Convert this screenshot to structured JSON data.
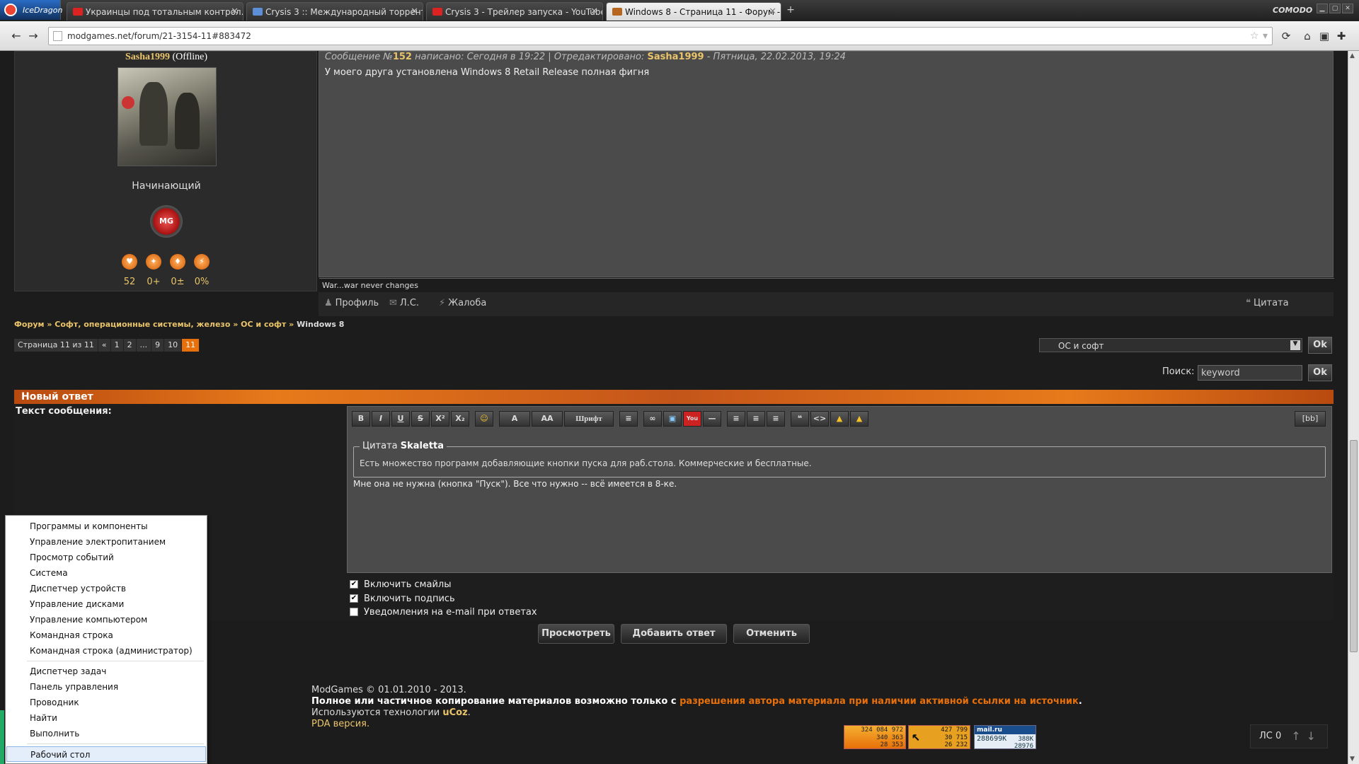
{
  "browser": {
    "name": "IceDragon",
    "comodo_label": "COMODO",
    "tabs": [
      {
        "title": "Украинцы под тотальным контрол...",
        "fav_color": "#d22"
      },
      {
        "title": "Crysis 3 :: Международный торрент-...",
        "fav_color": "#5c8fd6"
      },
      {
        "title": "Crysis 3 - Трейлер запуска - YouTube",
        "fav_color": "#d22"
      },
      {
        "title": "Windows 8 - Страница 11 - Форум -...",
        "fav_color": "#b5651d"
      }
    ],
    "url": "modgames.net/forum/21-3154-11#883472"
  },
  "post": {
    "username": "Sasha1999",
    "status": "(Offline)",
    "rank": "Начинающий",
    "badge": "MG",
    "stats": [
      "52",
      "0+",
      "0±",
      "0%"
    ],
    "meta_prefix": "Сообщение №",
    "meta_number": "152",
    "meta_written": " написано: Сегодня в 19:22 | ",
    "meta_edited": "Отредактировано: ",
    "meta_editor": "Sasha1999",
    "meta_edit_date": " - Пятница, 22.02.2013, 19:24",
    "text": "У моего друга установлена Windows 8 Retail Release полная фигня",
    "signature": "War...war never changes",
    "actions": {
      "profile": "Профиль",
      "pm": "Л.С.",
      "report": "Жалоба",
      "quote": "Цитата"
    }
  },
  "breadcrumb": {
    "forum": "Форум",
    "sep": " » ",
    "section": "Софт, операционные системы, железо",
    "subsection": "ОС и софт",
    "topic": "Windows 8"
  },
  "pager": {
    "label": "Страница 11 из 11",
    "items": [
      "«",
      "1",
      "2",
      "...",
      "9",
      "10",
      "11"
    ],
    "current": "11"
  },
  "jump": {
    "selected": "ОС и софт",
    "ok": "Ok"
  },
  "search": {
    "label": "Поиск:",
    "value": "keyword",
    "ok": "Ok"
  },
  "reply": {
    "header": "Новый ответ",
    "message_label": "Текст сообщения:",
    "toolbar": [
      "B",
      "I",
      "U",
      "S",
      "X²",
      "X₂",
      "☺",
      "A",
      "AA",
      "Шрифт",
      "≡",
      "∞",
      "▣",
      "You",
      "—",
      "≡",
      "≡",
      "≡",
      "❝",
      "<>",
      "▲",
      "▲"
    ],
    "bb_mode": "[bb]",
    "quote_label": "Цитата",
    "quote_author": "Skaletta",
    "quote_text": "Есть множество программ добавляющие кнопки пуска для раб.стола. Коммерческие и бесплатные.",
    "reply_text": "Мне она не нужна (кнопка \"Пуск\"). Все что нужно -- всё имеется в 8-ке.",
    "options": [
      {
        "label": "Включить смайлы",
        "checked": true
      },
      {
        "label": "Включить подпись",
        "checked": true
      },
      {
        "label": "Уведомления на e-mail при ответах",
        "checked": false
      }
    ],
    "buttons": {
      "preview": "Просмотреть",
      "submit": "Добавить ответ",
      "cancel": "Отменить"
    }
  },
  "footer": {
    "line1": "ModGames © 01.01.2010 - 2013.",
    "line2_a": "Полное или частичное копирование материалов возможно только с ",
    "line2_b": "разрешения автора материала при наличии активной ссылки на источник",
    "line2_c": ".",
    "line3_a": "Используются технологии ",
    "line3_b": "uCoz",
    "line3_c": ".",
    "line4": "PDA версия."
  },
  "counters": {
    "ucoz": [
      "324 084 972",
      "340 363",
      "28 353"
    ],
    "second": [
      "427 799",
      "30 715",
      "26 232"
    ],
    "mailru": [
      "288699K",
      "388K",
      "28976"
    ]
  },
  "ls": {
    "label": "ЛС 0"
  },
  "context_menu": {
    "items_group1": [
      "Программы и компоненты",
      "Управление электропитанием",
      "Просмотр событий",
      "Система",
      "Диспетчер устройств",
      "Управление дисками",
      "Управление компьютером",
      "Командная строка",
      "Командная строка (администратор)"
    ],
    "items_group2": [
      "Диспетчер задач",
      "Панель управления",
      "Проводник",
      "Найти",
      "Выполнить"
    ],
    "items_group3": [
      "Рабочий стол"
    ]
  }
}
